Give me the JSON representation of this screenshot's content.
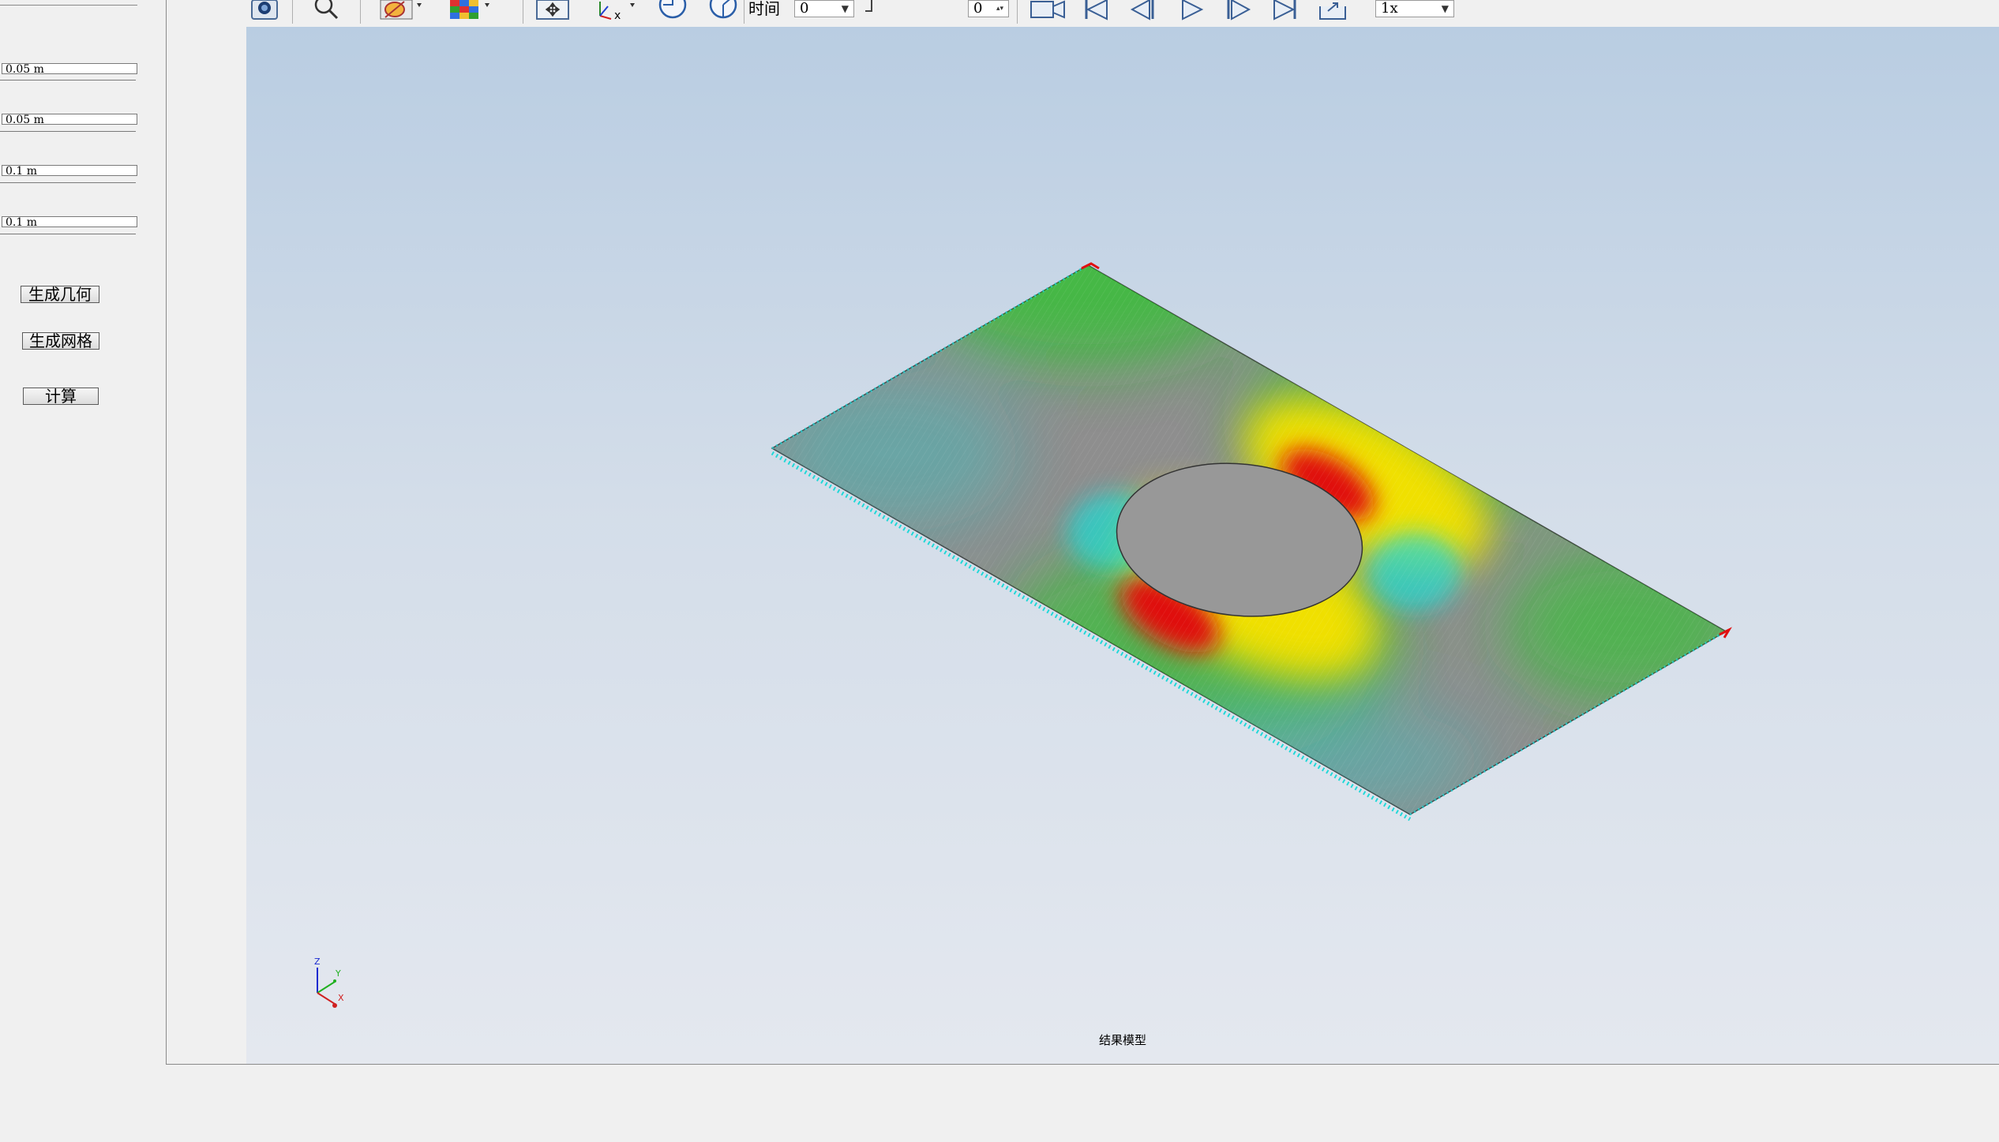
{
  "sidebar": {
    "params": [
      {
        "value": "0.05 m"
      },
      {
        "value": "0.05 m"
      },
      {
        "value": "0.1 m"
      },
      {
        "value": "0.1 m"
      }
    ],
    "buttons": {
      "generate_geometry": "生成几何",
      "generate_mesh": "生成网格",
      "compute": "计算"
    }
  },
  "toolbar": {
    "icons": [
      "camera-icon",
      "zoom-icon",
      "display-style-icon",
      "color-map-icon",
      "fit-view-icon",
      "axes-orientation-icon",
      "rotate-view-icon",
      "section-view-icon",
      "record-icon",
      "first-frame-icon",
      "previous-frame-icon",
      "play-icon",
      "next-frame-icon",
      "last-frame-icon",
      "export-icon"
    ],
    "time_label": "时间",
    "time_value": "0",
    "frame_value": "0",
    "speed_value": "1x"
  },
  "viewport": {
    "caption": "结果模型",
    "axes": {
      "z": "Z",
      "y": "Y",
      "x": "X"
    },
    "colors": {
      "plate": "#8e8e8e",
      "hole": "#989898",
      "high": "#e01010",
      "mid": "#f0e000",
      "low": "#20d020",
      "min": "#20d8d8",
      "bg_top": "#b9cde2",
      "bg_bottom": "#e4e8ef"
    }
  }
}
